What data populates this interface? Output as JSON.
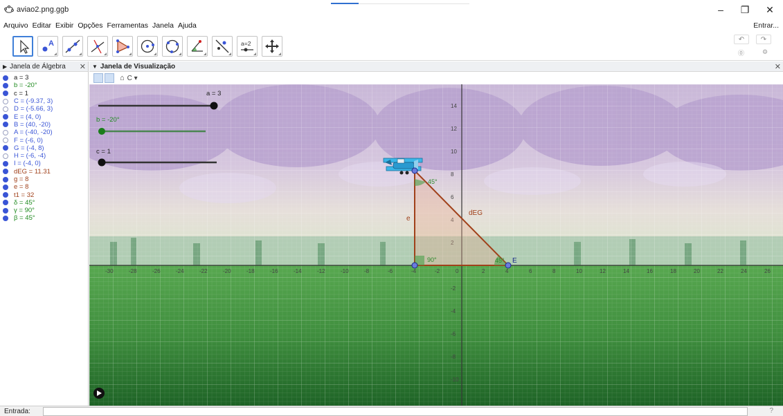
{
  "window": {
    "title": "aviao2.png.ggb",
    "minimize": "–",
    "restore": "❐",
    "close": "✕"
  },
  "menu": {
    "items": [
      "Arquivo",
      "Editar",
      "Exibir",
      "Opções",
      "Ferramentas",
      "Janela",
      "Ajuda"
    ],
    "signin": "Entrar..."
  },
  "toolbar": {
    "tools": [
      "move-tool",
      "point-tool",
      "line-tool",
      "perpendicular-tool",
      "polygon-tool",
      "circle-tool",
      "circle-three-points-tool",
      "angle-tool",
      "reflect-tool",
      "slider-tool",
      "move-graphics-tool"
    ],
    "slider_tool_label": "a=2",
    "undo": "↶",
    "redo": "↷"
  },
  "algebra": {
    "title": "Janela de Álgebra",
    "items": [
      {
        "text": "a = 3",
        "visible": true,
        "color": "#222222"
      },
      {
        "text": "b = -20°",
        "visible": true,
        "color": "#1f8a1f"
      },
      {
        "text": "c = 1",
        "visible": true,
        "color": "#222222"
      },
      {
        "text": "C = (-9.37, 3)",
        "visible": false,
        "color": "#3a55d6"
      },
      {
        "text": "D = (-5.66, 3)",
        "visible": false,
        "color": "#3a55d6"
      },
      {
        "text": "E = (4, 0)",
        "visible": true,
        "color": "#3a55d6"
      },
      {
        "text": "B = (40, -20)",
        "visible": true,
        "color": "#3a55d6"
      },
      {
        "text": "A = (-40, -20)",
        "visible": false,
        "color": "#3a55d6"
      },
      {
        "text": "F = (-6, 0)",
        "visible": false,
        "color": "#3a55d6"
      },
      {
        "text": "G = (-4, 8)",
        "visible": true,
        "color": "#3a55d6"
      },
      {
        "text": "H = (-6, -4)",
        "visible": false,
        "color": "#3a55d6"
      },
      {
        "text": "I = (-4, 0)",
        "visible": true,
        "color": "#3a55d6"
      },
      {
        "text": "dEG = 11.31",
        "visible": true,
        "color": "#a0401a"
      },
      {
        "text": "g = 8",
        "visible": true,
        "color": "#a0401a"
      },
      {
        "text": "e = 8",
        "visible": true,
        "color": "#a0401a"
      },
      {
        "text": "t1 = 32",
        "visible": true,
        "color": "#a0401a"
      },
      {
        "text": "δ = 45°",
        "visible": true,
        "color": "#1f8a1f"
      },
      {
        "text": "γ = 90°",
        "visible": true,
        "color": "#1f8a1f"
      },
      {
        "text": "β = 45°",
        "visible": true,
        "color": "#1f8a1f"
      }
    ]
  },
  "graphics": {
    "title": "Janela de Visualização",
    "home_icon": "⌂",
    "sliders": [
      {
        "label": "a = 3",
        "value": 3,
        "color": "#222222"
      },
      {
        "label": "b = -20°",
        "value": -20,
        "color": "#1f8a1f"
      },
      {
        "label": "c = 1",
        "value": 1,
        "color": "#222222"
      }
    ],
    "x_ticks": [
      "-30",
      "-28",
      "-26",
      "-24",
      "-22",
      "-20",
      "-18",
      "-16",
      "-14",
      "-12",
      "-10",
      "-8",
      "-6",
      "-4",
      "-2",
      "0",
      "2",
      "4",
      "6",
      "8",
      "10",
      "12",
      "14",
      "16",
      "18",
      "20",
      "22",
      "24",
      "26"
    ],
    "y_ticks": [
      "14",
      "12",
      "10",
      "8",
      "6",
      "4",
      "2",
      "-2",
      "-4",
      "-6",
      "-8",
      "-10"
    ],
    "segment_labels": {
      "hypotenuse": "dEG",
      "vertical": "e"
    },
    "angle_labels": {
      "top": "45°",
      "right": "45°",
      "bottom": "90°"
    },
    "point_labels": {
      "E": "E"
    }
  },
  "input": {
    "label": "Entrada:",
    "value": "",
    "help": "?"
  }
}
